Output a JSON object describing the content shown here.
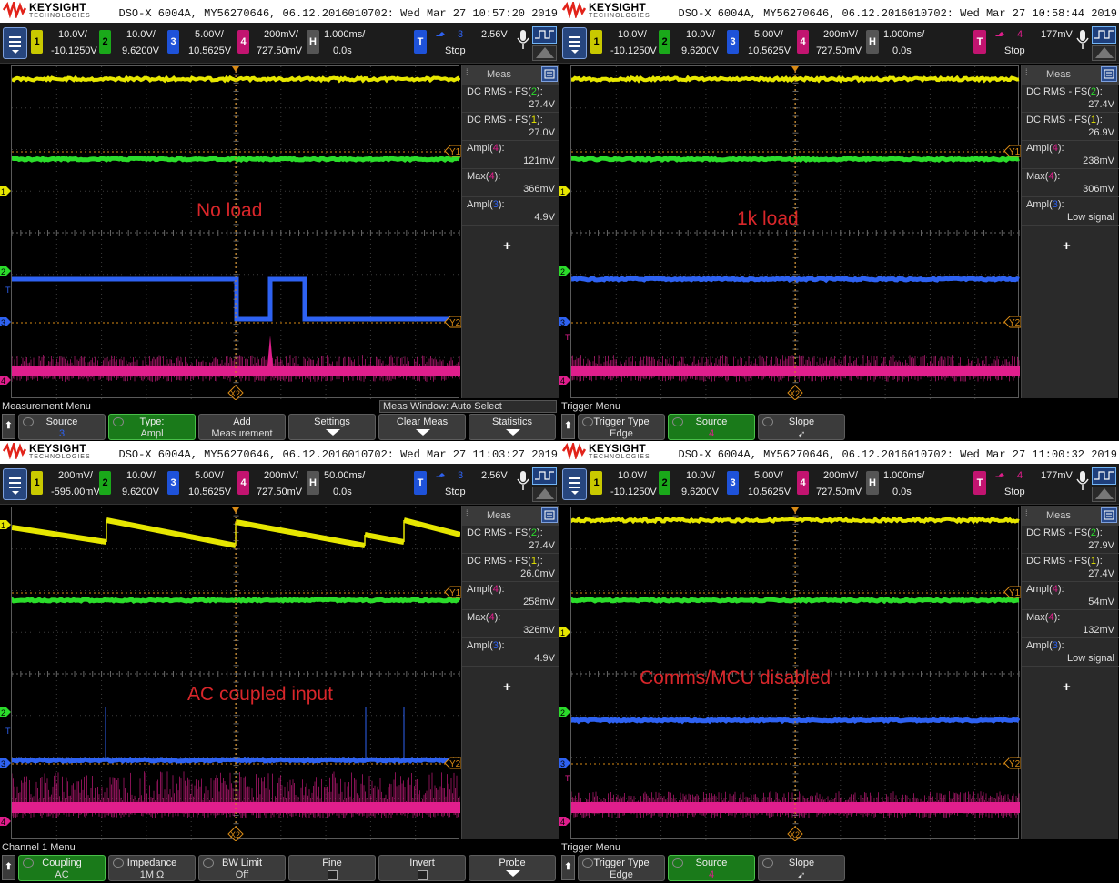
{
  "brand": {
    "name": "KEYSIGHT",
    "sub": "TECHNOLOGIES"
  },
  "colors": {
    "ch1": "#e6e600",
    "ch2": "#2bdc2b",
    "ch3": "#2e62f2",
    "ch4": "#e01e8c",
    "trig": "#d88a15",
    "annot": "#d8262a",
    "softkey_active": "#1a7a1a"
  },
  "panels": [
    {
      "id": "p1",
      "title": "DSO-X 6004A, MY56270646, 06.12.2016010702: Wed Mar 27 10:57:20 2019",
      "ch1": {
        "label": "1",
        "scale": "10.0V/",
        "offset": "-10.1250V"
      },
      "ch2": {
        "label": "2",
        "scale": "10.0V/",
        "offset": "9.6200V"
      },
      "ch3": {
        "label": "3",
        "scale": "5.00V/",
        "offset": "10.5625V"
      },
      "ch4": {
        "label": "4",
        "scale": "200mV/",
        "offset": "727.50mV"
      },
      "horiz": {
        "label": "H",
        "scale": "1.000ms/",
        "delay": "0.0s"
      },
      "trig": {
        "label": "T",
        "source": "3",
        "level": "2.56V",
        "status": "Stop"
      },
      "annotation": "No load",
      "meas_title": "Meas",
      "meas": [
        {
          "name": "DC RMS - FS",
          "src": "2",
          "value": "27.4V"
        },
        {
          "name": "DC RMS - FS",
          "src": "1",
          "value": "27.0V"
        },
        {
          "name": "Ampl",
          "src": "4",
          "value": "121mV"
        },
        {
          "name": "Max",
          "src": "4",
          "value": "366mV"
        },
        {
          "name": "Ampl",
          "src": "3",
          "value": "4.9V"
        }
      ],
      "menu_title": "Measurement Menu",
      "meas_window": "Meas Window: Auto Select",
      "softkeys": [
        {
          "l1": "Source",
          "l2": "3",
          "active": false
        },
        {
          "l1": "Type:",
          "l2": "Ampl",
          "active": true
        },
        {
          "l1": "Add",
          "l2": "Measurement",
          "active": false
        },
        {
          "l1": "Settings",
          "l2": "",
          "active": false
        },
        {
          "l1": "Clear Meas",
          "l2": "",
          "active": false
        },
        {
          "l1": "Statistics",
          "l2": "",
          "active": false
        }
      ],
      "markers": {
        "y1": "Y1",
        "y2": "Y2",
        "x2": "X2"
      }
    },
    {
      "id": "p2",
      "title": "DSO-X 6004A, MY56270646, 06.12.2016010702: Wed Mar 27 10:58:44 2019",
      "ch1": {
        "label": "1",
        "scale": "10.0V/",
        "offset": "-10.1250V"
      },
      "ch2": {
        "label": "2",
        "scale": "10.0V/",
        "offset": "9.6200V"
      },
      "ch3": {
        "label": "3",
        "scale": "5.00V/",
        "offset": "10.5625V"
      },
      "ch4": {
        "label": "4",
        "scale": "200mV/",
        "offset": "727.50mV"
      },
      "horiz": {
        "label": "H",
        "scale": "1.000ms/",
        "delay": "0.0s"
      },
      "trig": {
        "label": "T",
        "source": "4",
        "level": "177mV",
        "status": "Stop"
      },
      "annotation": "1k load",
      "meas_title": "Meas",
      "meas": [
        {
          "name": "DC RMS - FS",
          "src": "2",
          "value": "27.4V"
        },
        {
          "name": "DC RMS - FS",
          "src": "1",
          "value": "26.9V"
        },
        {
          "name": "Ampl",
          "src": "4",
          "value": "238mV"
        },
        {
          "name": "Max",
          "src": "4",
          "value": "306mV"
        },
        {
          "name": "Ampl",
          "src": "3",
          "value": "Low signal"
        }
      ],
      "menu_title": "Trigger Menu",
      "softkeys": [
        {
          "l1": "Trigger Type",
          "l2": "Edge",
          "active": false
        },
        {
          "l1": "Source",
          "l2": "4",
          "active": true
        },
        {
          "l1": "Slope",
          "l2": "➹",
          "active": false
        }
      ],
      "markers": {
        "y1": "Y1",
        "y2": "Y2",
        "x2": "X2"
      }
    },
    {
      "id": "p3",
      "title": "DSO-X 6004A, MY56270646, 06.12.2016010702: Wed Mar 27 11:03:27 2019",
      "ch1": {
        "label": "1",
        "scale": "200mV/",
        "offset": "-595.00mV"
      },
      "ch2": {
        "label": "2",
        "scale": "10.0V/",
        "offset": "9.6200V"
      },
      "ch3": {
        "label": "3",
        "scale": "5.00V/",
        "offset": "10.5625V"
      },
      "ch4": {
        "label": "4",
        "scale": "200mV/",
        "offset": "727.50mV"
      },
      "horiz": {
        "label": "H",
        "scale": "50.00ms/",
        "delay": "0.0s"
      },
      "trig": {
        "label": "T",
        "source": "3",
        "level": "2.56V",
        "status": "Stop"
      },
      "annotation": "AC coupled input",
      "meas_title": "Meas",
      "meas": [
        {
          "name": "DC RMS - FS",
          "src": "2",
          "value": "27.4V"
        },
        {
          "name": "DC RMS - FS",
          "src": "1",
          "value": "26.0mV"
        },
        {
          "name": "Ampl",
          "src": "4",
          "value": "258mV"
        },
        {
          "name": "Max",
          "src": "4",
          "value": "326mV"
        },
        {
          "name": "Ampl",
          "src": "3",
          "value": "4.9V"
        }
      ],
      "menu_title": "Channel 1 Menu",
      "softkeys": [
        {
          "l1": "Coupling",
          "l2": "AC",
          "active": true
        },
        {
          "l1": "Impedance",
          "l2": "1M Ω",
          "active": false
        },
        {
          "l1": "BW Limit",
          "l2": "Off",
          "active": false
        },
        {
          "l1": "Fine",
          "l2": "",
          "active": false
        },
        {
          "l1": "Invert",
          "l2": "",
          "active": false
        },
        {
          "l1": "Probe",
          "l2": "",
          "active": false
        }
      ],
      "markers": {
        "y1": "Y1",
        "y2": "Y2",
        "x2": "X2"
      }
    },
    {
      "id": "p4",
      "title": "DSO-X 6004A, MY56270646, 06.12.2016010702: Wed Mar 27 11:00:32 2019",
      "ch1": {
        "label": "1",
        "scale": "10.0V/",
        "offset": "-10.1250V"
      },
      "ch2": {
        "label": "2",
        "scale": "10.0V/",
        "offset": "9.6200V"
      },
      "ch3": {
        "label": "3",
        "scale": "5.00V/",
        "offset": "10.5625V"
      },
      "ch4": {
        "label": "4",
        "scale": "200mV/",
        "offset": "727.50mV"
      },
      "horiz": {
        "label": "H",
        "scale": "1.000ms/",
        "delay": "0.0s"
      },
      "trig": {
        "label": "T",
        "source": "4",
        "level": "177mV",
        "status": "Stop"
      },
      "annotation": "Comms/MCU disabled",
      "meas_title": "Meas",
      "meas": [
        {
          "name": "DC RMS - FS",
          "src": "2",
          "value": "27.9V"
        },
        {
          "name": "DC RMS - FS",
          "src": "1",
          "value": "27.4V"
        },
        {
          "name": "Ampl",
          "src": "4",
          "value": "54mV"
        },
        {
          "name": "Max",
          "src": "4",
          "value": "132mV"
        },
        {
          "name": "Ampl",
          "src": "3",
          "value": "Low signal"
        }
      ],
      "menu_title": "Trigger Menu",
      "softkeys": [
        {
          "l1": "Trigger Type",
          "l2": "Edge",
          "active": false
        },
        {
          "l1": "Source",
          "l2": "4",
          "active": true
        },
        {
          "l1": "Slope",
          "l2": "➹",
          "active": false
        }
      ],
      "markers": {
        "y1": "Y1",
        "y2": "Y2",
        "x2": "X2"
      }
    }
  ]
}
